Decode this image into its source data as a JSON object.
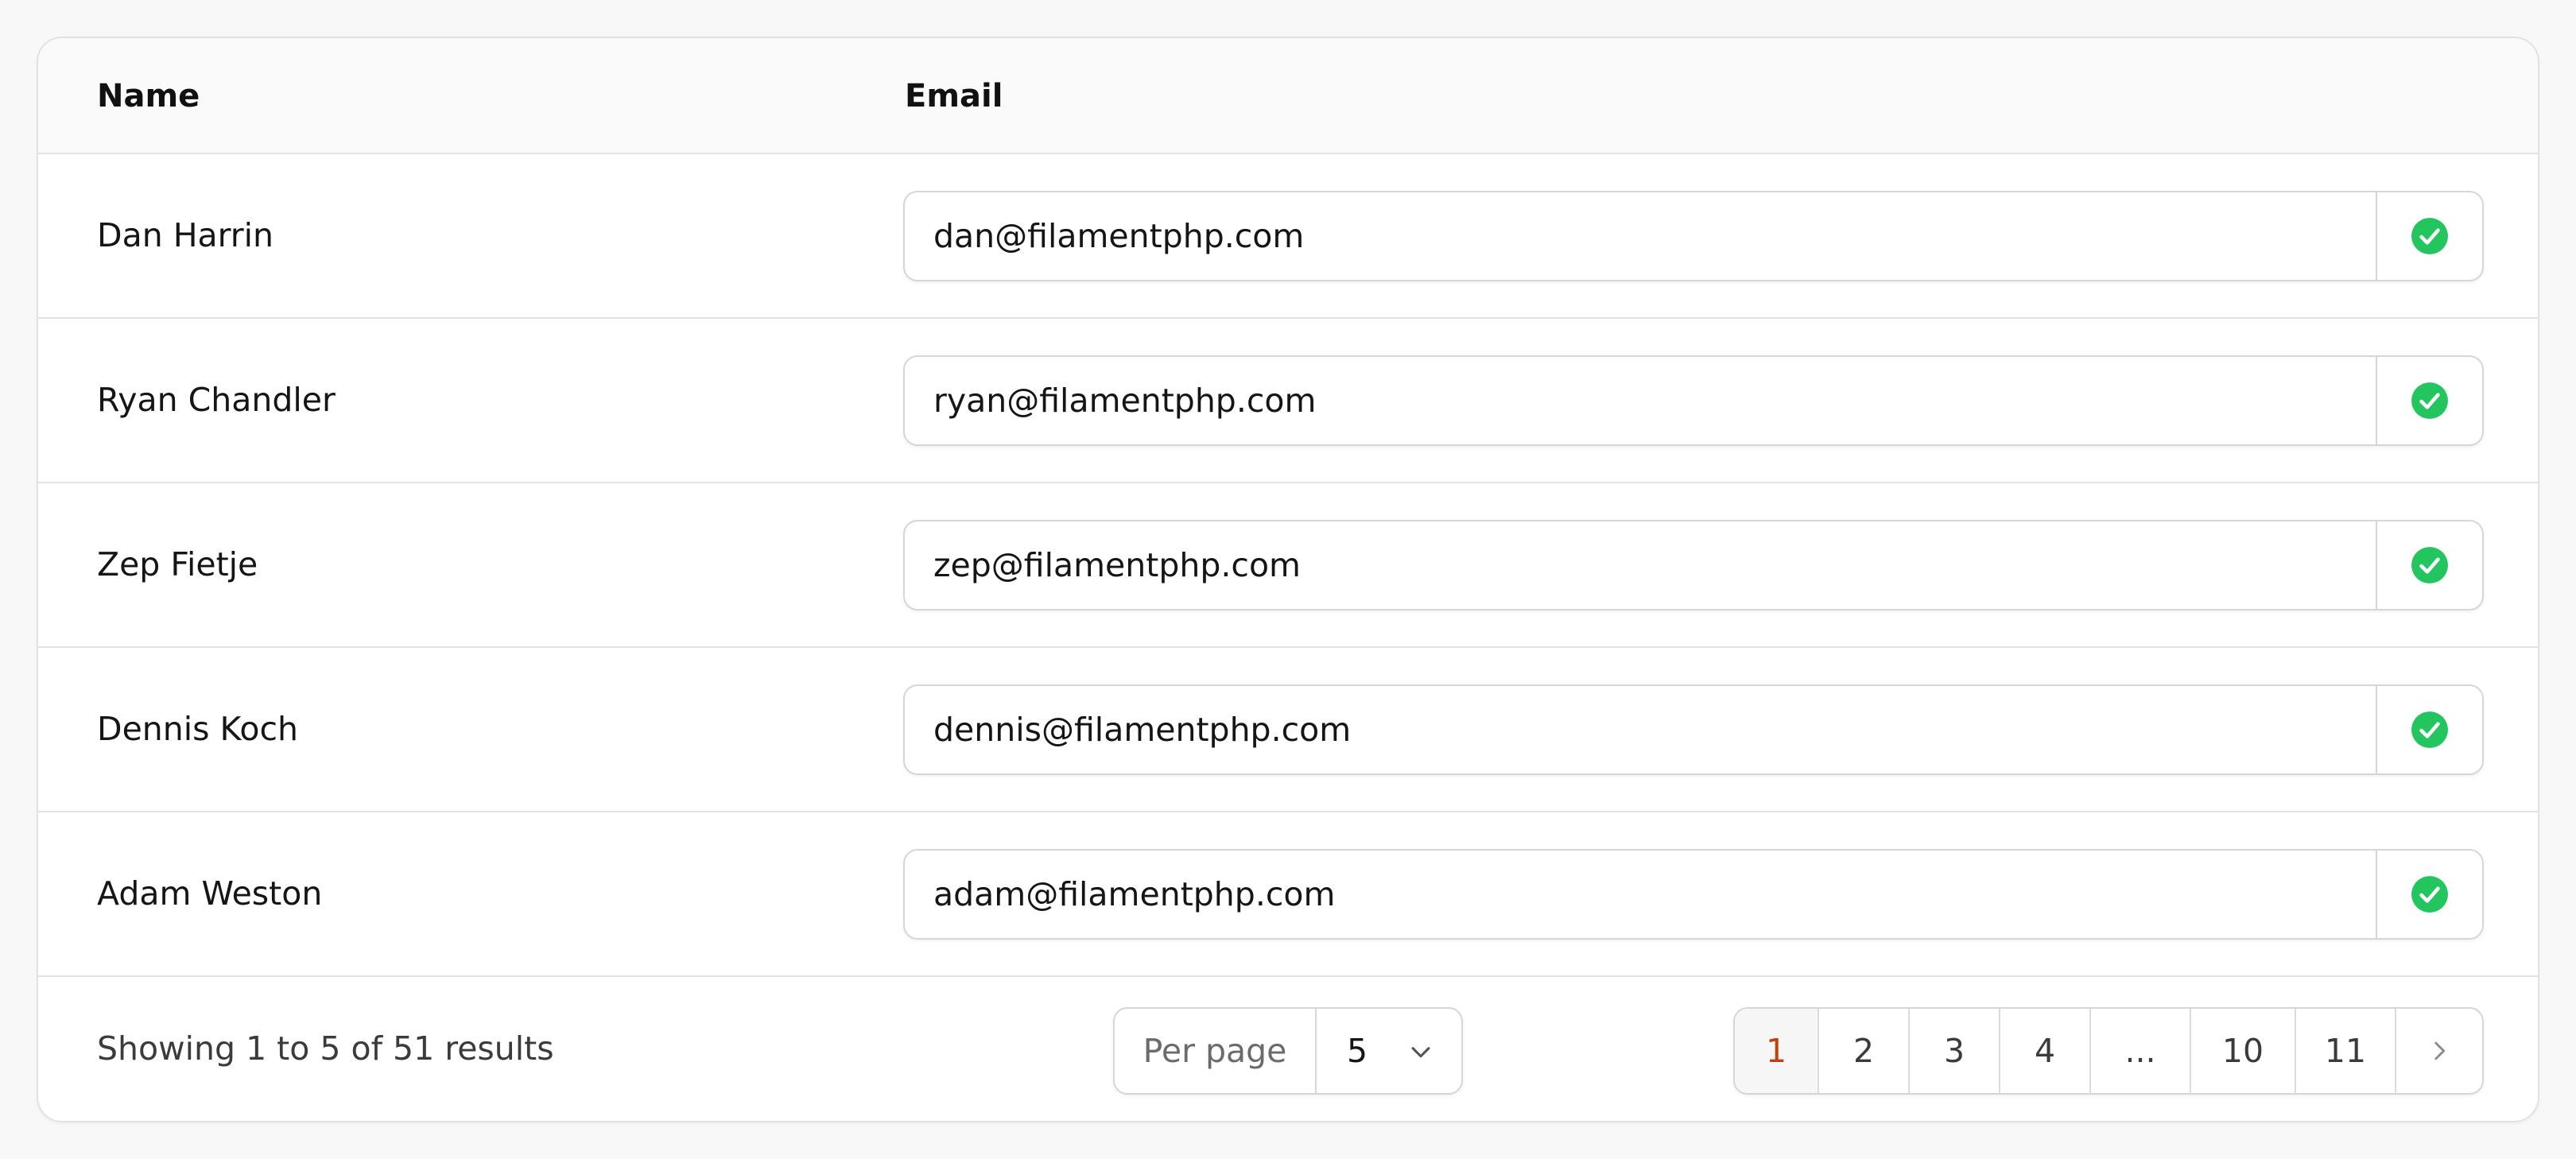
{
  "table": {
    "headers": {
      "name": "Name",
      "email": "Email"
    },
    "rows": [
      {
        "name": "Dan Harrin",
        "email": "dan@filamentphp.com"
      },
      {
        "name": "Ryan Chandler",
        "email": "ryan@filamentphp.com"
      },
      {
        "name": "Zep Fietje",
        "email": "zep@filamentphp.com"
      },
      {
        "name": "Dennis Koch",
        "email": "dennis@filamentphp.com"
      },
      {
        "name": "Adam Weston",
        "email": "adam@filamentphp.com"
      }
    ],
    "valid_icon": "check-circle-icon"
  },
  "footer": {
    "results_text": "Showing 1 to 5 of 51 results",
    "per_page_label": "Per page",
    "per_page_value": "5",
    "pages": [
      "1",
      "2",
      "3",
      "4",
      "...",
      "10",
      "11"
    ],
    "current_page": "1",
    "next_icon": "chevron-right-icon"
  },
  "colors": {
    "valid": "#22c55e",
    "active_page": "#c2410c"
  }
}
